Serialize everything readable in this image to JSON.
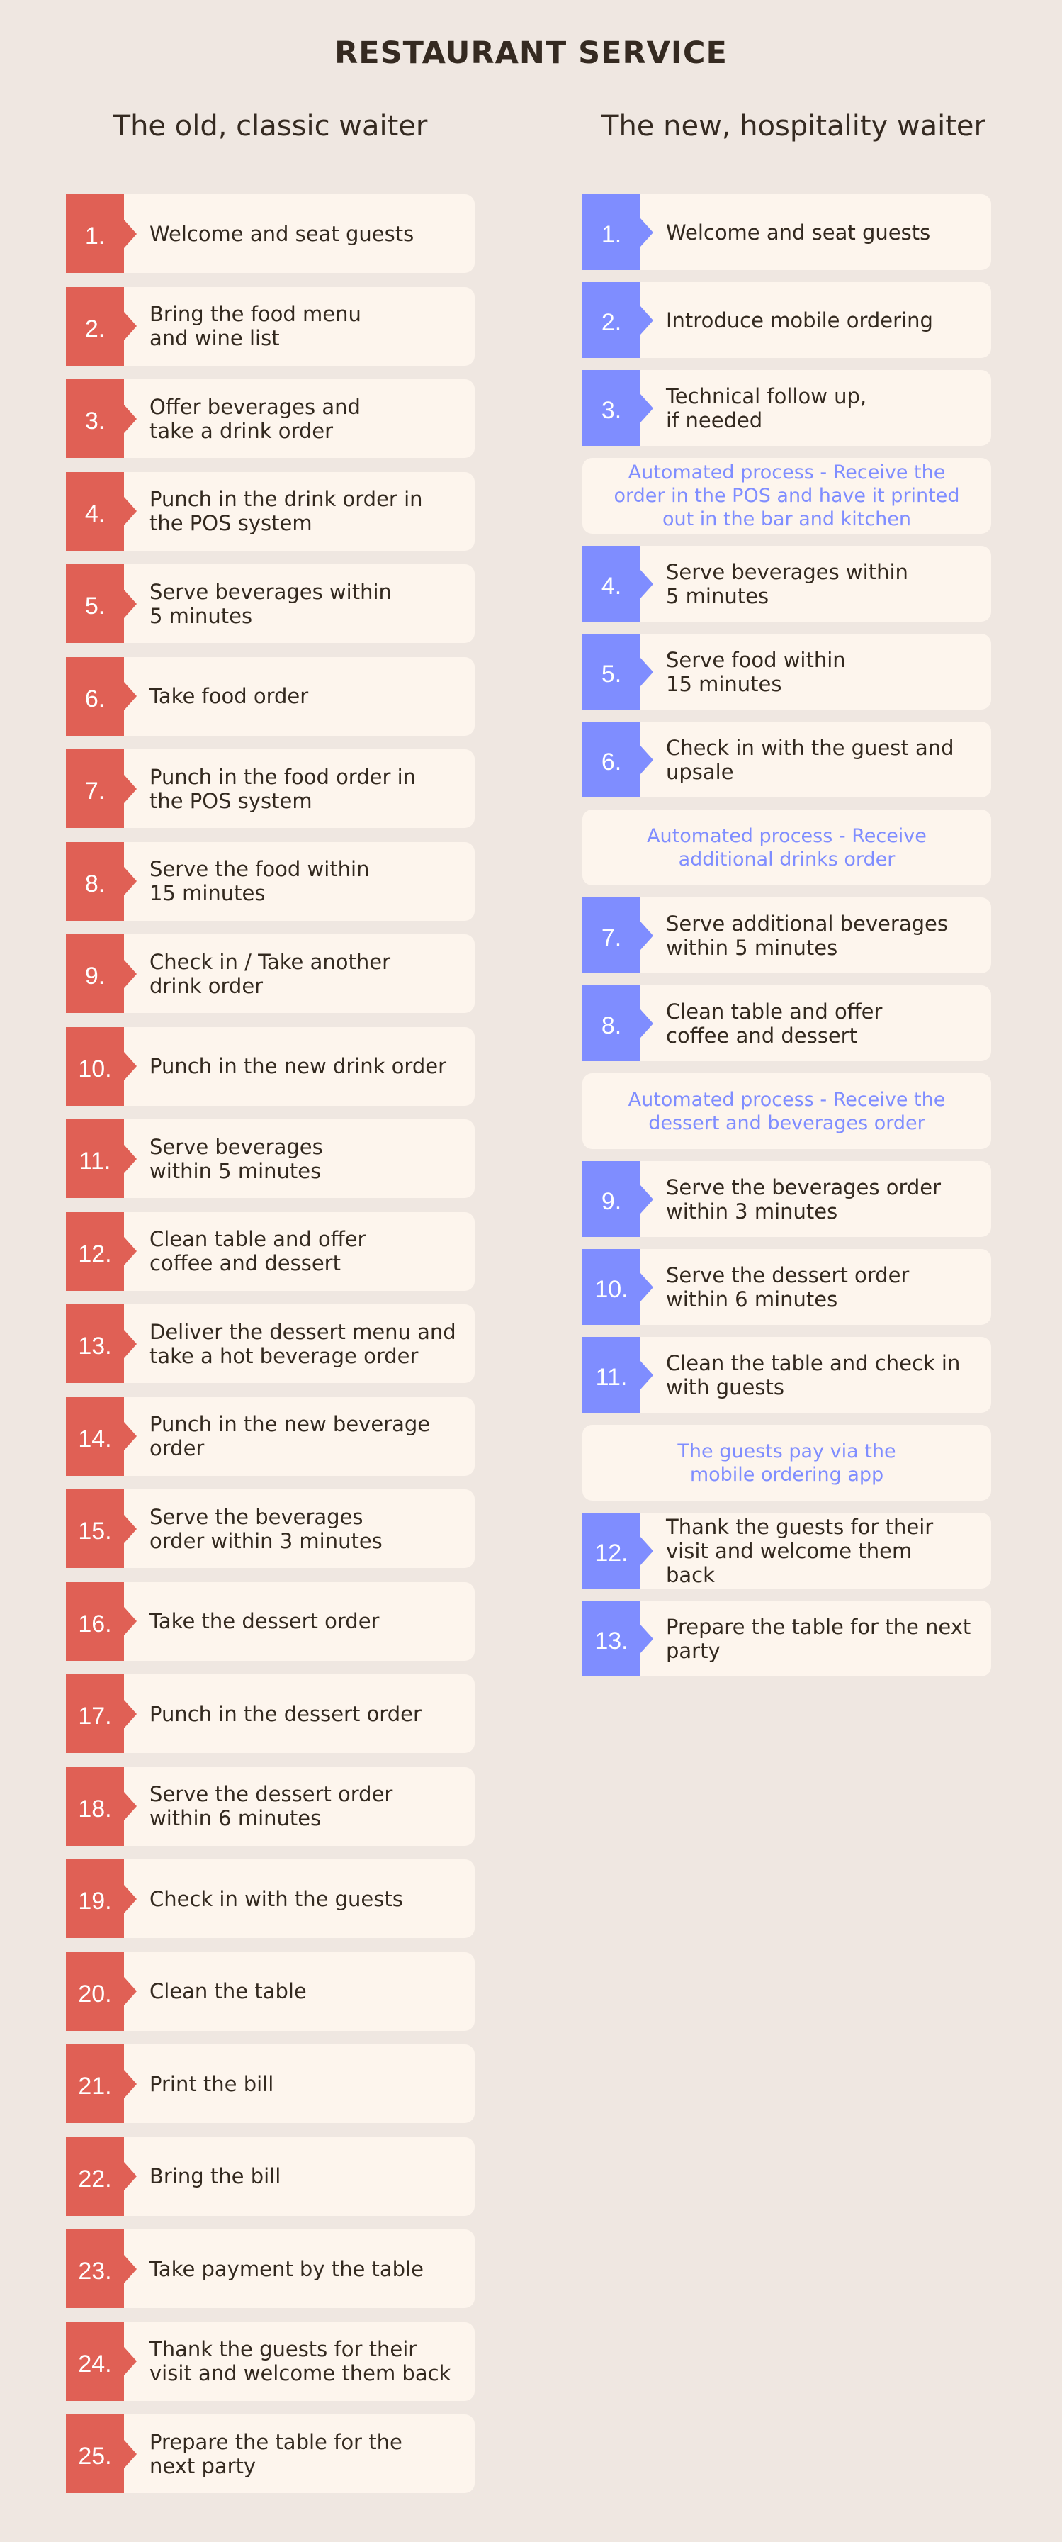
{
  "title": "RESTAURANT SERVICE",
  "colors": {
    "background": "#efe7e1",
    "card": "#fdf5ed",
    "old_accent": "#e06055",
    "new_accent": "#7f8dff",
    "text": "#33291f"
  },
  "old_waiter": {
    "heading": "The old, classic waiter",
    "steps": [
      {
        "num": "1.",
        "text": "Welcome and seat guests"
      },
      {
        "num": "2.",
        "text": "Bring the food menu\nand wine list"
      },
      {
        "num": "3.",
        "text": "Offer beverages and\ntake a drink order"
      },
      {
        "num": "4.",
        "text": "Punch in the drink order in\nthe POS system"
      },
      {
        "num": "5.",
        "text": "Serve beverages within\n5 minutes"
      },
      {
        "num": "6.",
        "text": "Take food order"
      },
      {
        "num": "7.",
        "text": "Punch in the food order in\nthe POS system"
      },
      {
        "num": "8.",
        "text": "Serve the food within\n15 minutes"
      },
      {
        "num": "9.",
        "text": "Check in / Take another\ndrink order"
      },
      {
        "num": "10.",
        "text": "Punch in the new drink order"
      },
      {
        "num": "11.",
        "text": "Serve beverages\nwithin 5 minutes"
      },
      {
        "num": "12.",
        "text": "Clean table and offer\ncoffee and dessert"
      },
      {
        "num": "13.",
        "text": "Deliver the dessert menu and\ntake a hot beverage order"
      },
      {
        "num": "14.",
        "text": "Punch in the new beverage\norder"
      },
      {
        "num": "15.",
        "text": "Serve the beverages\norder within 3 minutes"
      },
      {
        "num": "16.",
        "text": "Take the dessert order"
      },
      {
        "num": "17.",
        "text": "Punch in the dessert order"
      },
      {
        "num": "18.",
        "text": "Serve the dessert order\nwithin 6 minutes"
      },
      {
        "num": "19.",
        "text": "Check in with the guests"
      },
      {
        "num": "20.",
        "text": "Clean the table"
      },
      {
        "num": "21.",
        "text": "Print the bill"
      },
      {
        "num": "22.",
        "text": "Bring the bill"
      },
      {
        "num": "23.",
        "text": "Take payment by the table"
      },
      {
        "num": "24.",
        "text": "Thank the guests for their\nvisit and welcome them back"
      },
      {
        "num": "25.",
        "text": "Prepare the table for the\nnext party"
      }
    ]
  },
  "new_waiter": {
    "heading": "The new, hospitality waiter",
    "items": [
      {
        "type": "step",
        "num": "1.",
        "text": "Welcome and seat guests"
      },
      {
        "type": "step",
        "num": "2.",
        "text": "Introduce mobile ordering"
      },
      {
        "type": "step",
        "num": "3.",
        "text": "Technical follow up,\nif needed"
      },
      {
        "type": "note",
        "text": "Automated process - Receive the\norder in the POS and have it printed\nout in the bar and kitchen"
      },
      {
        "type": "step",
        "num": "4.",
        "text": "Serve beverages within\n5 minutes"
      },
      {
        "type": "step",
        "num": "5.",
        "text": "Serve food within\n15 minutes"
      },
      {
        "type": "step",
        "num": "6.",
        "text": "Check in with the guest and\nupsale"
      },
      {
        "type": "note",
        "text": "Automated process - Receive\nadditional drinks order"
      },
      {
        "type": "step",
        "num": "7.",
        "text": "Serve additional beverages\nwithin 5 minutes"
      },
      {
        "type": "step",
        "num": "8.",
        "text": "Clean table and offer\ncoffee and dessert"
      },
      {
        "type": "note",
        "text": "Automated process - Receive the\ndessert and beverages order"
      },
      {
        "type": "step",
        "num": "9.",
        "text": "Serve the beverages order\nwithin 3 minutes"
      },
      {
        "type": "step",
        "num": "10.",
        "text": "Serve the dessert order\nwithin 6 minutes"
      },
      {
        "type": "step",
        "num": "11.",
        "text": "Clean the table and check in\nwith guests"
      },
      {
        "type": "note",
        "text": "The guests pay via the\nmobile ordering app"
      },
      {
        "type": "step",
        "num": "12.",
        "text": "Thank the guests for their\nvisit and welcome them\nback"
      },
      {
        "type": "step",
        "num": "13.",
        "text": "Prepare the table for the next\nparty"
      }
    ]
  }
}
